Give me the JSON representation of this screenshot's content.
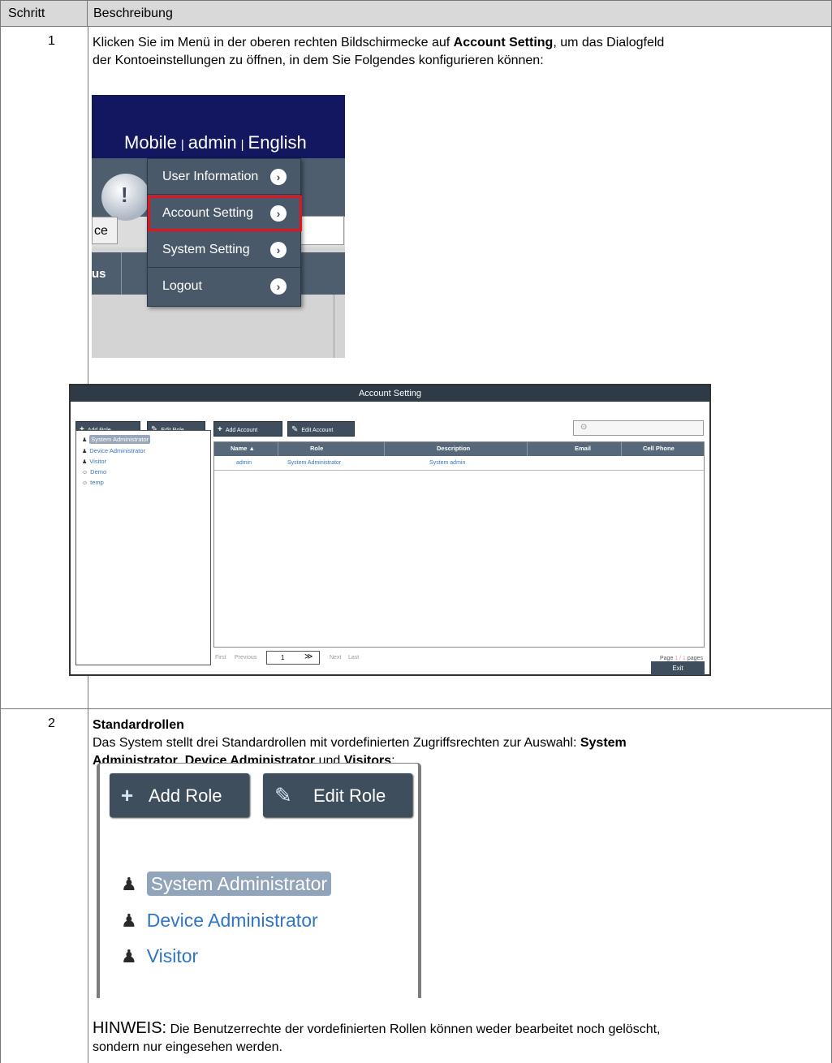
{
  "table": {
    "header": {
      "col1": "Schritt",
      "col2": "Beschreibung"
    },
    "rows": [
      {
        "step": "1",
        "text_before": "Klicken Sie im Menü in der oberen rechten Bildschirmecke auf ",
        "text_bold": "Account Setting",
        "text_after": ", um das Dialogfeld",
        "text_line2": "der Kontoeinstellungen zu öffnen, in dem Sie Folgendes konfigurieren können:"
      },
      {
        "step": "2",
        "heading": "Standardrollen",
        "text_line1_before": "Das System stellt drei Standardrollen mit vordefinierten Zugriffsrechten zur Auswahl: ",
        "text_line1_bold": "System",
        "text_line2_bold1": "Administrator",
        "text_line2_sep1": ", ",
        "text_line2_bold2": "Device Administrator",
        "text_line2_sep2": " und ",
        "text_line2_bold3": "Visitors",
        "text_line2_end": ":",
        "note_label": "HINWEIS:",
        "note_text_line1": " Die Benutzerrechte der vordefinierten Rollen können weder bearbeitet noch gelöscht,",
        "note_text_line2": "sondern nur eingesehen werden."
      }
    ]
  },
  "menu_shot": {
    "topnav": {
      "mobile": "Mobile",
      "sep": "|",
      "admin": "admin",
      "english": "English"
    },
    "bubble_icon": "exclamation-bubble-icon",
    "bubble_glyph": "!",
    "ce_text": "ce",
    "us_text": "us",
    "items": [
      {
        "label": "User Information",
        "arrow": "›"
      },
      {
        "label": "Account Setting",
        "arrow": "›"
      },
      {
        "label": "System Setting",
        "arrow": "›"
      },
      {
        "label": "Logout",
        "arrow": "›"
      }
    ],
    "highlight_color": "#e2141c"
  },
  "dialog": {
    "title": "Account Setting",
    "add_role": "Add Role",
    "edit_role": "Edit Role",
    "add_account": "Add Account",
    "edit_account": "Edit Account",
    "plus_glyph": "+",
    "pencil_glyph": "✎",
    "search_glyph": "⊙",
    "user_glyph": "♟",
    "roles": [
      {
        "name": "System Administrator",
        "icon": "user-icon",
        "glyph": "♟"
      },
      {
        "name": "Device Administrator",
        "icon": "user-icon",
        "glyph": "♟"
      },
      {
        "name": "Visitor",
        "icon": "user-icon",
        "glyph": "♟"
      },
      {
        "name": "Demo",
        "icon": "user-group-icon",
        "glyph": "☺"
      },
      {
        "name": "temp",
        "icon": "user-group-icon",
        "glyph": "☺"
      }
    ],
    "columns": [
      "Name ▲",
      "Role",
      "Description",
      "Email",
      "Cell Phone"
    ],
    "rows": [
      {
        "name": "admin",
        "role": "System Administrator",
        "description": "System admin",
        "email": "",
        "phone": ""
      }
    ],
    "pager": {
      "first": "First",
      "previous": "Previous",
      "page": "1",
      "dropdown": "≫",
      "next": "Next",
      "last": "Last"
    },
    "page_info": {
      "prefix": "Page ",
      "current": "1 / 1",
      "suffix": " pages"
    },
    "exit": "Exit"
  },
  "roles_shot": {
    "add_role": "Add Role",
    "edit_role": "Edit Role",
    "plus_glyph": "+",
    "pencil_glyph": "✎",
    "roles": [
      {
        "name": "System Administrator",
        "glyph": "♟"
      },
      {
        "name": "Device Administrator",
        "glyph": "♟"
      },
      {
        "name": "Visitor",
        "glyph": "♟"
      }
    ]
  }
}
